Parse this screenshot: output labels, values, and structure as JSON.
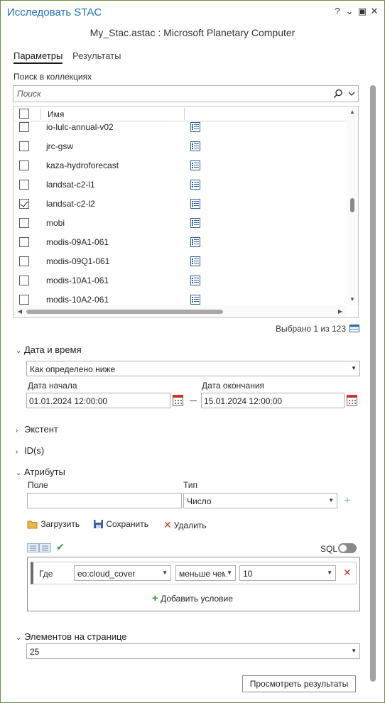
{
  "window": {
    "title": "Исследовать STAC",
    "subtitle": "My_Stac.astac : Microsoft Planetary Computer",
    "help_glyph": "?",
    "menu_glyph": "⌄",
    "restore_glyph": "▣",
    "close_glyph": "✕"
  },
  "tabs": [
    {
      "label": "Параметры",
      "active": true
    },
    {
      "label": "Результаты",
      "active": false
    }
  ],
  "collections": {
    "label": "Поиск в коллекциях",
    "search_placeholder": "Поиск",
    "column_name": "Имя",
    "rows": [
      {
        "name": "io-lulc-annual-v02",
        "checked": false
      },
      {
        "name": "jrc-gsw",
        "checked": false
      },
      {
        "name": "kaza-hydroforecast",
        "checked": false
      },
      {
        "name": "landsat-c2-l1",
        "checked": false
      },
      {
        "name": "landsat-c2-l2",
        "checked": true
      },
      {
        "name": "mobi",
        "checked": false
      },
      {
        "name": "modis-09A1-061",
        "checked": false
      },
      {
        "name": "modis-09Q1-061",
        "checked": false
      },
      {
        "name": "modis-10A1-061",
        "checked": false
      },
      {
        "name": "modis-10A2-061",
        "checked": false
      }
    ],
    "selected_text": "Выбрано 1 из 123"
  },
  "datetime": {
    "header": "Дата и время",
    "mode": "Как определено ниже",
    "start_label": "Дата начала",
    "start_value": "01.01.2024 12:00:00",
    "end_label": "Дата окончания",
    "end_value": "15.01.2024 12:00:00"
  },
  "extent": {
    "header": "Экстент"
  },
  "ids": {
    "header": "ID(s)"
  },
  "attributes": {
    "header": "Атрибуты",
    "field_label": "Поле",
    "field_value": "",
    "type_label": "Тип",
    "type_value": "Число",
    "load_label": "Загрузить",
    "save_label": "Сохранить",
    "delete_label": "Удалить",
    "sql_label": "SQL",
    "where_label": "Где",
    "cond_field": "eo:cloud_cover",
    "cond_operator": "меньше чем",
    "cond_value": "10",
    "add_condition_label": "Добавить условие"
  },
  "paging": {
    "header": "Элементов на странице",
    "value": "25"
  },
  "actions": {
    "view_results": "Просмотреть результаты"
  },
  "colors": {
    "title_blue": "#1f6fbf",
    "frame_green": "#6b8f3a",
    "delete_red": "#c0392b",
    "add_green": "#3a9a3a"
  }
}
